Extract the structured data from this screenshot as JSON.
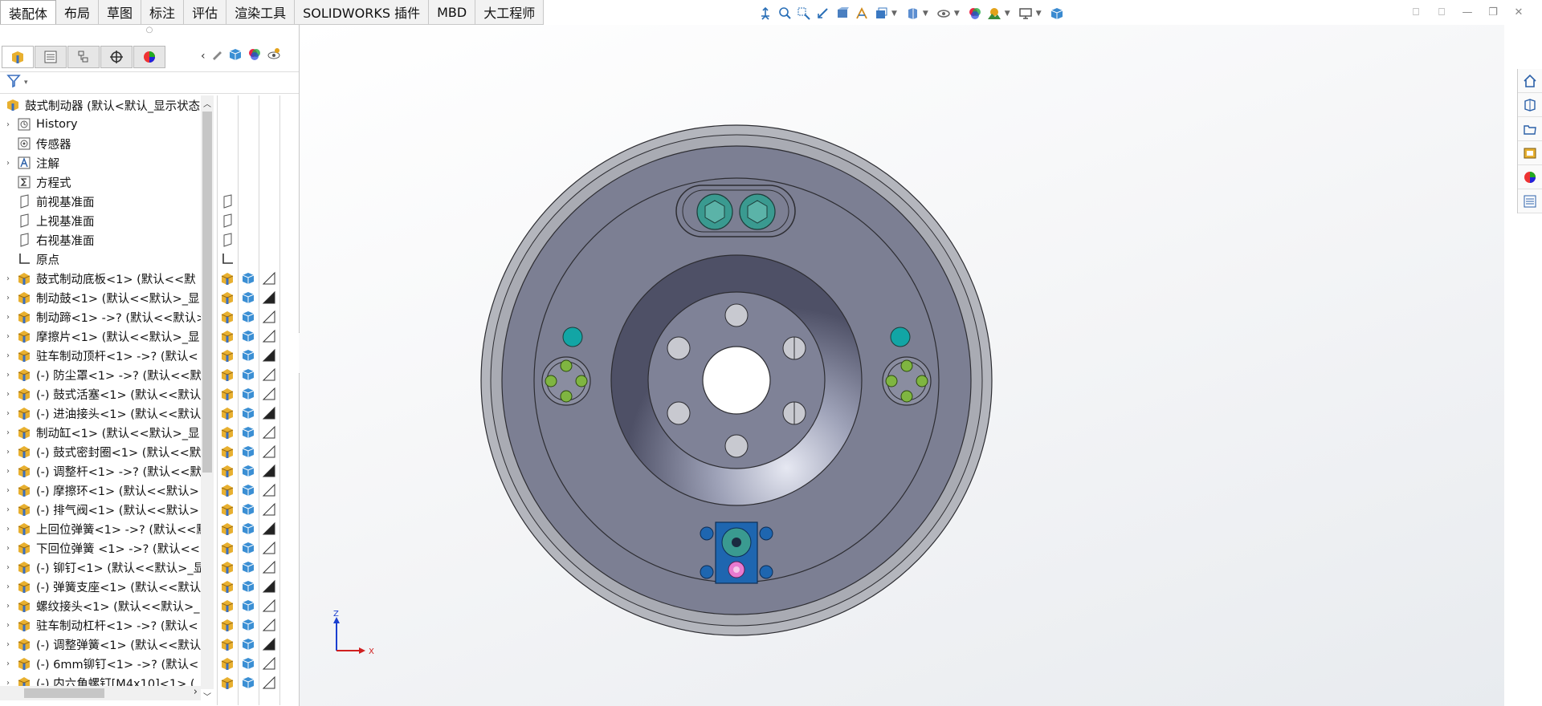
{
  "ribbon": {
    "tabs": [
      "装配体",
      "布局",
      "草图",
      "标注",
      "评估",
      "渲染工具",
      "SOLIDWORKS 插件",
      "MBD",
      "大工程师"
    ]
  },
  "hud": {
    "icons": [
      "view-orient-icon",
      "zoom-to-fit-icon",
      "zoom-area-icon",
      "previous-view-icon",
      "section-view-icon",
      "dynamic-annotation-icon",
      "display-style-icon",
      "hide-show-icon",
      "edit-appearance-icon",
      "apply-scene-icon",
      "view-settings-icon",
      "display-cube-icon"
    ]
  },
  "tree": {
    "root": "鼓式制动器 (默认<默认_显示状态",
    "items": [
      {
        "label": "History",
        "icon": "history-icon",
        "expand": true
      },
      {
        "label": "传感器",
        "icon": "sensor-icon",
        "expand": false
      },
      {
        "label": "注解",
        "icon": "annotation-icon",
        "expand": true
      },
      {
        "label": "方程式",
        "icon": "equation-icon",
        "expand": false
      },
      {
        "label": "前视基准面",
        "icon": "plane-icon",
        "expand": false
      },
      {
        "label": "上视基准面",
        "icon": "plane-icon",
        "expand": false
      },
      {
        "label": "右视基准面",
        "icon": "plane-icon",
        "expand": false
      },
      {
        "label": "原点",
        "icon": "origin-icon",
        "expand": false
      },
      {
        "label": "鼓式制动底板<1> (默认<<默",
        "icon": "part-icon",
        "expand": true
      },
      {
        "label": "制动鼓<1> (默认<<默认>_显",
        "icon": "part-icon",
        "expand": true
      },
      {
        "label": "制动蹄<1> ->? (默认<<默认>",
        "icon": "part-icon",
        "expand": true
      },
      {
        "label": "摩擦片<1> (默认<<默认>_显",
        "icon": "part-icon",
        "expand": true
      },
      {
        "label": "驻车制动顶杆<1> ->? (默认<",
        "icon": "part-icon",
        "expand": true
      },
      {
        "label": "(-) 防尘罩<1> ->? (默认<<默",
        "icon": "part-icon",
        "expand": true
      },
      {
        "label": "(-) 鼓式活塞<1> (默认<<默认",
        "icon": "part-icon",
        "expand": true
      },
      {
        "label": "(-) 进油接头<1> (默认<<默认",
        "icon": "part-icon",
        "expand": true
      },
      {
        "label": "制动缸<1> (默认<<默认>_显",
        "icon": "part-icon",
        "expand": true
      },
      {
        "label": "(-) 鼓式密封圈<1> (默认<<默",
        "icon": "part-icon",
        "expand": true
      },
      {
        "label": "(-) 调整杆<1> ->? (默认<<默",
        "icon": "part-icon",
        "expand": true
      },
      {
        "label": "(-) 摩擦环<1> (默认<<默认>",
        "icon": "part-icon",
        "expand": true
      },
      {
        "label": "(-) 排气阀<1> (默认<<默认>",
        "icon": "part-icon",
        "expand": true
      },
      {
        "label": "上回位弹簧<1> ->? (默认<<默",
        "icon": "part-icon",
        "expand": true
      },
      {
        "label": "下回位弹簧 <1> ->? (默认<<",
        "icon": "part-icon",
        "expand": true
      },
      {
        "label": "(-) 铆钉<1> (默认<<默认>_显",
        "icon": "part-icon",
        "expand": true
      },
      {
        "label": "(-) 弹簧支座<1> (默认<<默认",
        "icon": "part-icon",
        "expand": true
      },
      {
        "label": "螺纹接头<1> (默认<<默认>_",
        "icon": "part-icon",
        "expand": true
      },
      {
        "label": "驻车制动杠杆<1> ->? (默认<",
        "icon": "part-icon",
        "expand": true
      },
      {
        "label": "(-) 调整弹簧<1> (默认<<默认",
        "icon": "part-icon",
        "expand": true
      },
      {
        "label": "(-) 6mm铆钉<1> ->? (默认<",
        "icon": "part-icon",
        "expand": true
      },
      {
        "label": "(-) 内六角螺钉[M4x10]<1> (",
        "icon": "part-icon",
        "expand": true
      }
    ]
  },
  "triad": {
    "x_label": "X",
    "z_label": "Z"
  },
  "colors": {
    "accent": "#0a5fb4",
    "part_gray": "#7c7f93",
    "teal": "#3a9a90",
    "bolt": "#1aa0a0",
    "blue_block": "#1e66b0"
  }
}
